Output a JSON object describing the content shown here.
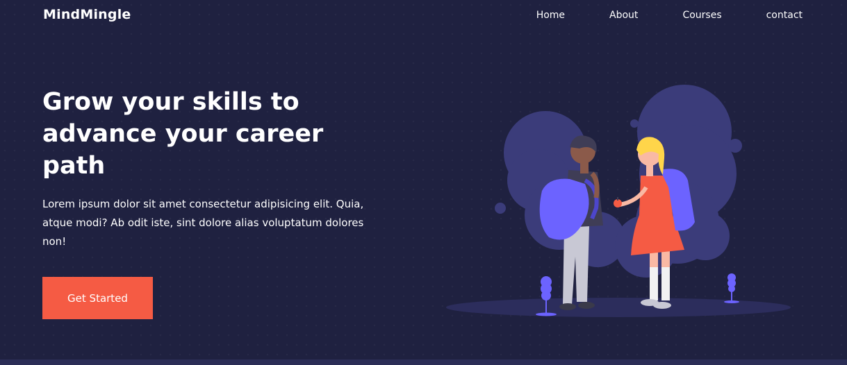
{
  "nav": {
    "brand": "MindMingle",
    "links": [
      {
        "label": "Home"
      },
      {
        "label": "About"
      },
      {
        "label": "Courses"
      },
      {
        "label": "contact"
      }
    ]
  },
  "hero": {
    "title": "Grow your skills to advance your career path",
    "description": "Lorem ipsum dolor sit amet consectetur adipisicing elit. Quia, atque modi? Ab odit iste, sint dolore alias voluptatum dolores non!",
    "cta_label": "Get Started",
    "illustration": "two-students-with-backpacks-illustration"
  },
  "colors": {
    "background": "#1f2140",
    "accent": "#f55b44",
    "illustration_blob": "#3b3c7a",
    "backpack": "#6c63ff"
  }
}
